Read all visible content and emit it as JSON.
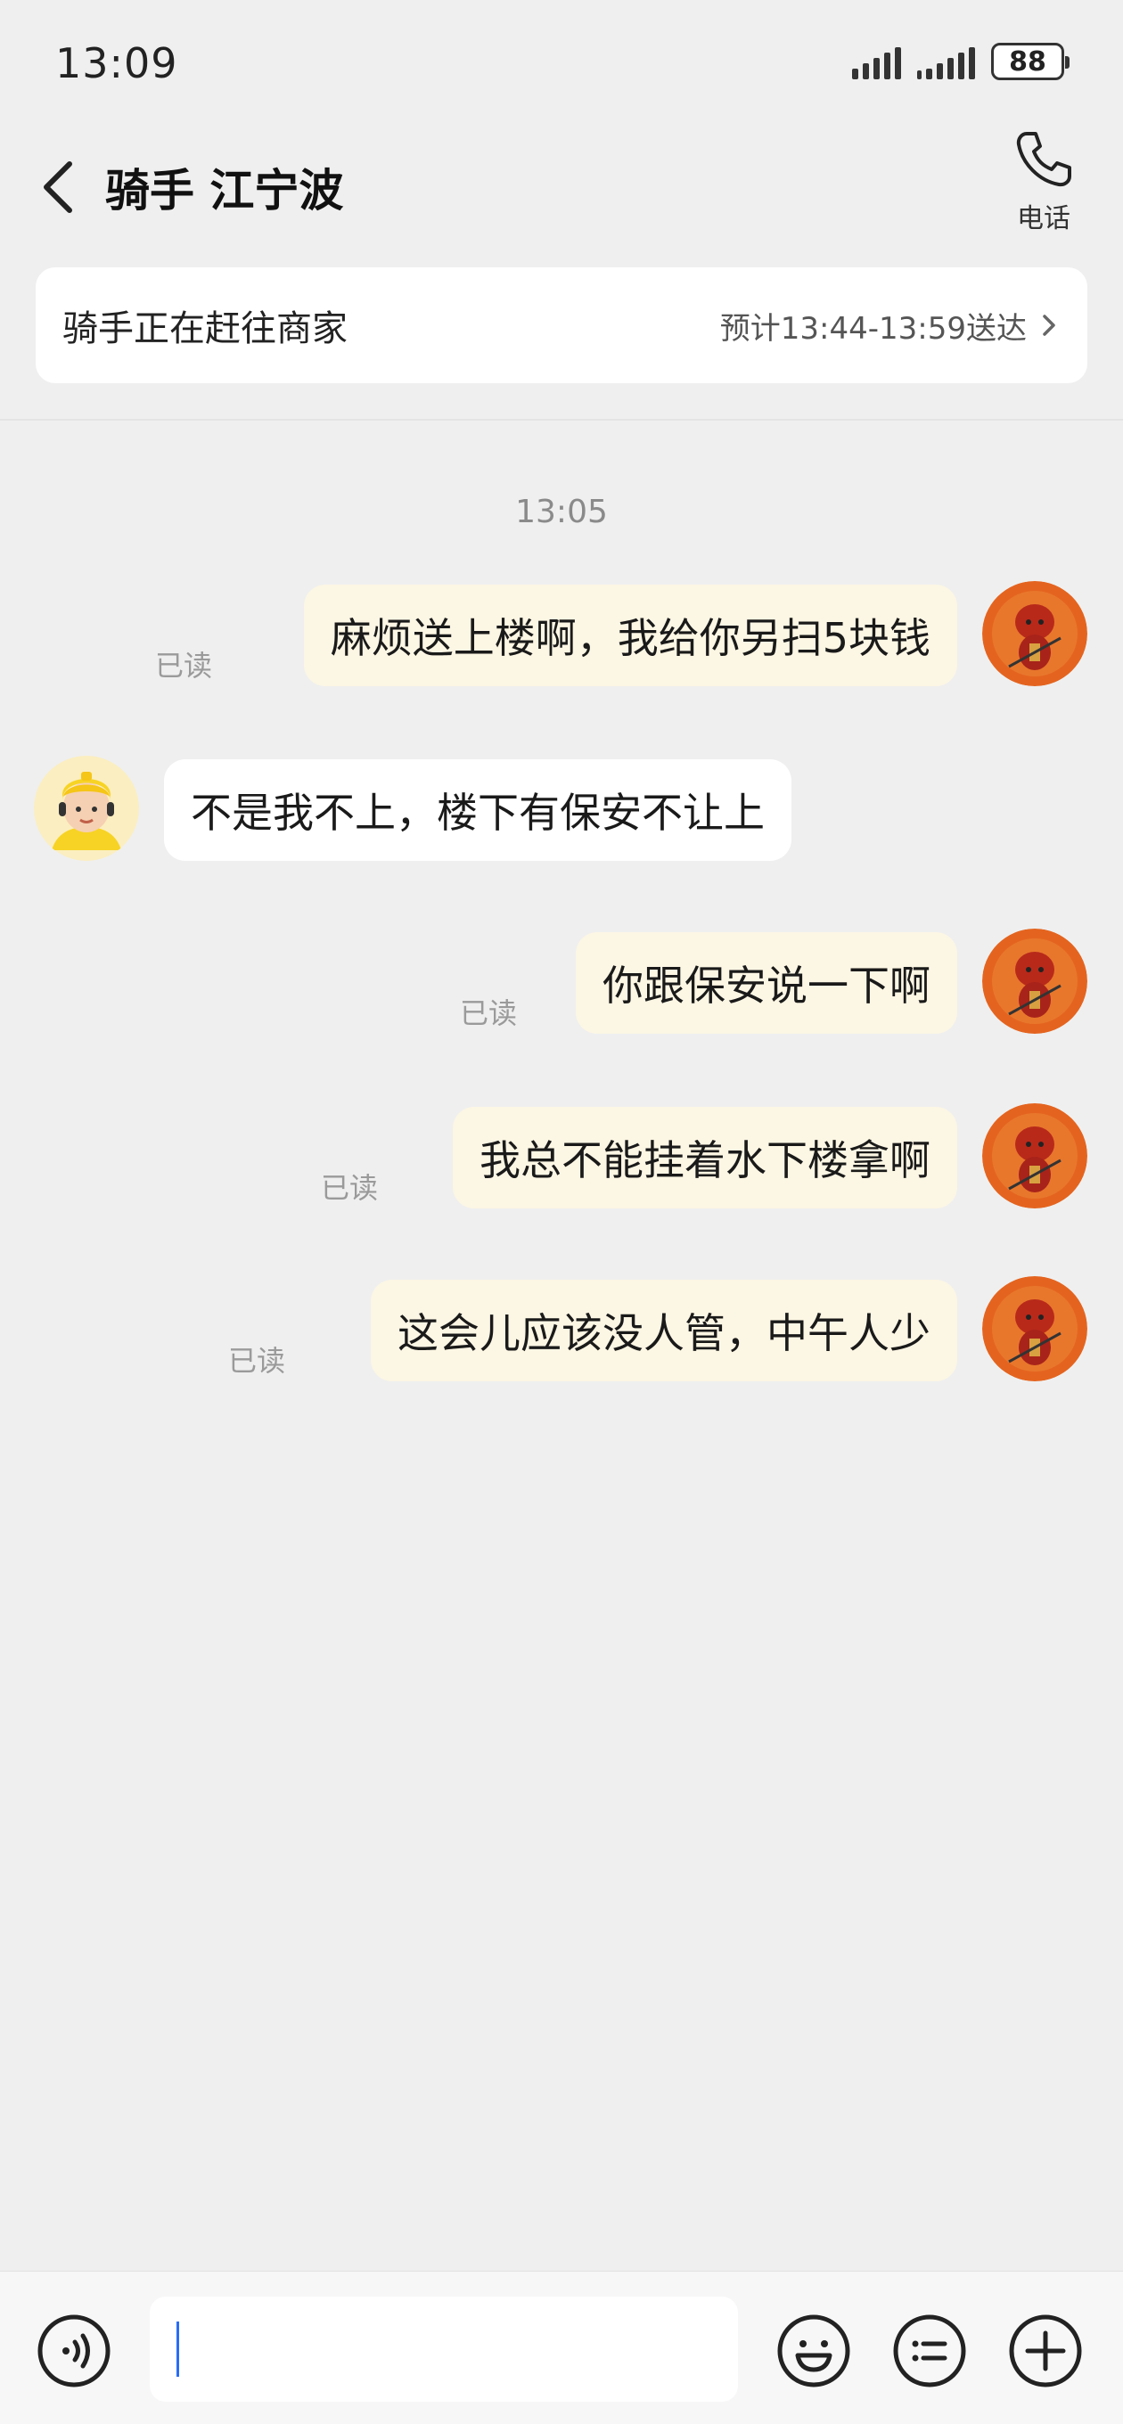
{
  "status_bar": {
    "time": "13:09",
    "battery": "88"
  },
  "header": {
    "title": "骑手 江宁波",
    "call_label": "电话"
  },
  "delivery": {
    "status": "骑手正在赶往商家",
    "eta": "预计13:44-13:59送达"
  },
  "chat": {
    "timestamp": "13:05",
    "messages": [
      {
        "sender": "me",
        "text": "麻烦送上楼啊，我给你另扫5块钱",
        "read": "已读"
      },
      {
        "sender": "rider",
        "text": "不是我不上，楼下有保安不让上"
      },
      {
        "sender": "me",
        "text": "你跟保安说一下啊",
        "read": "已读"
      },
      {
        "sender": "me",
        "text": "我总不能挂着水下楼拿啊",
        "read": "已读"
      },
      {
        "sender": "me",
        "text": "这会儿应该没人管，中午人少",
        "read": "已读"
      }
    ]
  },
  "input": {
    "value": "",
    "icons": [
      "voice-icon",
      "emoji-icon",
      "quick-reply-icon",
      "plus-icon"
    ]
  },
  "colors": {
    "background": "#efefef",
    "my_bubble": "#fcf6e4",
    "rider_bubble": "#ffffff",
    "caret": "#2a6df4"
  }
}
